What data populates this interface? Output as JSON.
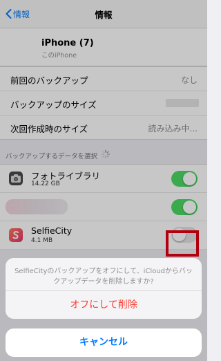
{
  "nav": {
    "back_label": "情報",
    "title": "情報"
  },
  "device": {
    "name": "iPhone (7)",
    "subtitle": "このiPhone"
  },
  "info_rows": [
    {
      "label": "前回のバックアップ",
      "value": "なし"
    },
    {
      "label": "バックアップのサイズ",
      "value": ""
    },
    {
      "label": "次回作成時のサイズ",
      "value": "読み込み中..."
    }
  ],
  "section": {
    "label": "バックアップするデータを選択"
  },
  "apps": [
    {
      "name": "フォトライブラリ",
      "size": "14.22 GB",
      "enabled": true,
      "icon": "camera-icon"
    },
    {
      "name": "",
      "size": "",
      "enabled": true,
      "icon": "blurred-app-icon"
    },
    {
      "name": "SelfieCity",
      "size": "4.1 MB",
      "enabled": false,
      "icon": "selfiecity-icon"
    }
  ],
  "action_sheet": {
    "message": "SelfieCityのバックアップをオフにして、iCloudからバックアップデータを削除しますか?",
    "destructive_label": "オフにして削除",
    "cancel_label": "キャンセル"
  },
  "colors": {
    "ios_blue": "#007aff",
    "ios_red": "#ff3b30",
    "toggle_on": "#4cd964",
    "highlight": "#e60012"
  }
}
